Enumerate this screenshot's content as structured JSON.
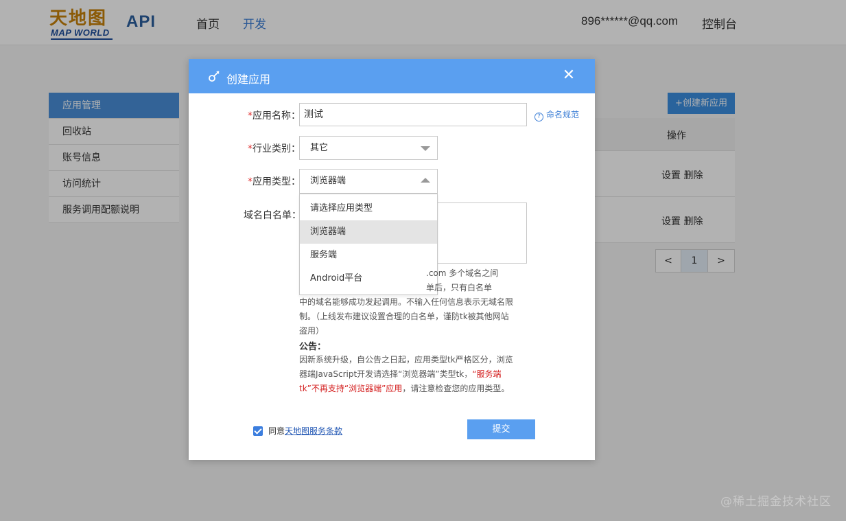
{
  "header": {
    "logo_cn": "天地图",
    "logo_en": "MAP WORLD",
    "brand": "API",
    "nav": [
      "首页",
      "开发"
    ],
    "user_email": "896******@qq.com",
    "console": "控制台"
  },
  "sidebar": {
    "items": [
      {
        "label": "应用管理",
        "active": true
      },
      {
        "label": "回收站"
      },
      {
        "label": "账号信息"
      },
      {
        "label": "访问统计"
      },
      {
        "label": "服务调用配额说明"
      }
    ]
  },
  "main": {
    "create_button": "+创建新应用",
    "table_header_ops": "操作",
    "rows": [
      {
        "ops": "设置 删除"
      },
      {
        "ops": "设置 删除"
      }
    ],
    "pager": {
      "prev": "<",
      "current": "1",
      "next": ">"
    }
  },
  "modal": {
    "title": "创建应用",
    "close": "✕",
    "fields": {
      "name": {
        "label": "应用名称：",
        "value": "测试",
        "required": "*"
      },
      "industry": {
        "label": "行业类别：",
        "value": "其它",
        "required": "*"
      },
      "type": {
        "label": "应用类型：",
        "value": "浏览器端",
        "required": "*"
      },
      "domain": {
        "label": "域名白名单："
      }
    },
    "naming_link": "命名规范",
    "type_options": [
      "请选择应用类型",
      "浏览器端",
      "服务端",
      "Android平台"
    ],
    "help_tail_1": ".com 多个域名之间",
    "help_tail_2": "单后，只有白名单",
    "help_main": "中的域名能够成功发起调用。不输入任何信息表示无域名限制。（上线发布建议设置合理的白名单，谨防tk被其他网站盗用）",
    "notice_title": "公告：",
    "notice_text_1": "因新系统升级，自公告之日起，应用类型tk严格区分，浏览器端JavaScript开发请选择“浏览器端”类型tk，",
    "notice_text_red": "“服务端tk”不再支持“浏览器端”应用",
    "notice_text_2": "，请注意检查您的应用类型。",
    "agree_prefix": "同意",
    "terms_link": "天地图服务条款",
    "submit": "提交"
  },
  "watermark": "@稀土掘金技术社区"
}
